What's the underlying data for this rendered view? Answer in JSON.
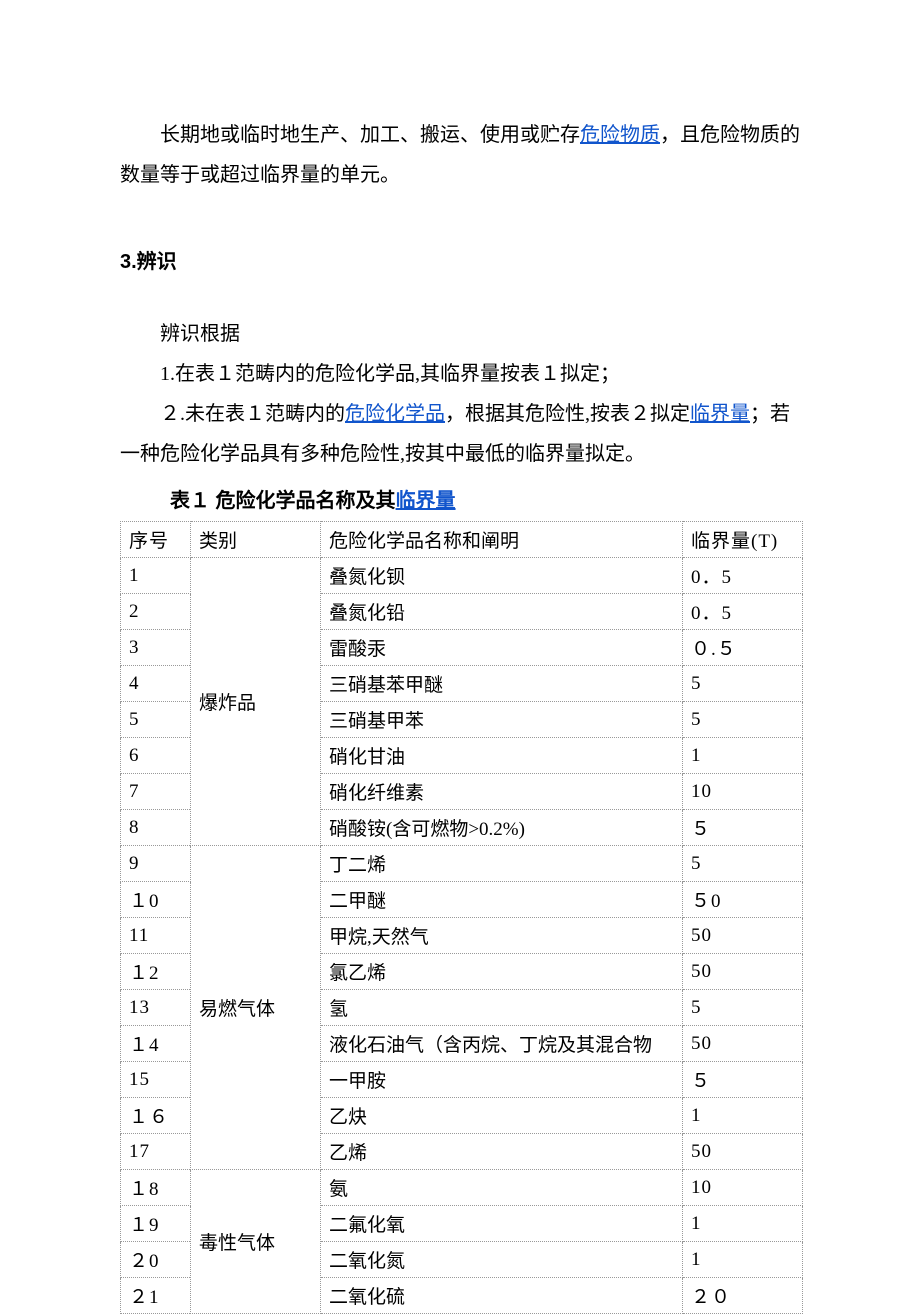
{
  "intro": {
    "prefix": "长期地或临时地生产、加工、搬运、使用或贮存",
    "link": "危险物质",
    "suffix": "，且危险物质的数量等于或超过临界量的单元。"
  },
  "section3": {
    "heading": "3.辨识",
    "subtitle": "辨识根据",
    "item1": "1.在表１范畴内的危险化学品,其临界量按表１拟定；",
    "item2": {
      "prefix": "２.未在表１范畴内的",
      "link1": "危险化学品",
      "mid": "，根据其危险性,按表２拟定",
      "link2": "临界量",
      "suffix": "；若一种危险化学品具有多种危险性,按其中最低的临界量拟定。"
    }
  },
  "table1": {
    "title_prefix": "表１ 危险化学品名称及其",
    "title_link": "临界量",
    "headers": {
      "seq": "序号",
      "cat": "类别",
      "name": "危险化学品名称和阐明",
      "qty": "临界量(T)"
    },
    "cats": {
      "c1": "爆炸品",
      "c2": "易燃气体",
      "c3": "毒性气体"
    },
    "rows": [
      {
        "seq": "1",
        "name": "叠氮化钡",
        "qty": "0．5"
      },
      {
        "seq": "2",
        "name": "叠氮化铅",
        "qty": "0．5"
      },
      {
        "seq": "3",
        "name": "雷酸汞",
        "qty": "０.５"
      },
      {
        "seq": "4",
        "name": "三硝基苯甲醚",
        "qty": "5"
      },
      {
        "seq": "5",
        "name": "三硝基甲苯",
        "qty": "5"
      },
      {
        "seq": "6",
        "name": "硝化甘油",
        "qty": "1"
      },
      {
        "seq": "7",
        "name": "硝化纤维素",
        "qty": "10"
      },
      {
        "seq": "8",
        "name": "硝酸铵(含可燃物>0.2%)",
        "qty": "５"
      },
      {
        "seq": "9",
        "name": "丁二烯",
        "qty": "5"
      },
      {
        "seq": "１0",
        "name": "二甲醚",
        "qty": "５0"
      },
      {
        "seq": "11",
        "name": "甲烷,天然气",
        "qty": "50"
      },
      {
        "seq": "１2",
        "name": "氯乙烯",
        "qty": "50"
      },
      {
        "seq": "13",
        "name": "氢",
        "qty": "5"
      },
      {
        "seq": "１4",
        "name": "液化石油气（含丙烷、丁烷及其混合物",
        "qty": "50"
      },
      {
        "seq": "15",
        "name": "一甲胺",
        "qty": "５"
      },
      {
        "seq": "１６",
        "name": "乙炔",
        "qty": "1"
      },
      {
        "seq": "17",
        "name": "乙烯",
        "qty": "50"
      },
      {
        "seq": "１8",
        "name": "氨",
        "qty": "10"
      },
      {
        "seq": "１9",
        "name": "二氟化氧",
        "qty": "1"
      },
      {
        "seq": "２0",
        "name": "二氧化氮",
        "qty": "1"
      },
      {
        "seq": "２1",
        "name": "二氧化硫",
        "qty": "２０"
      }
    ]
  }
}
